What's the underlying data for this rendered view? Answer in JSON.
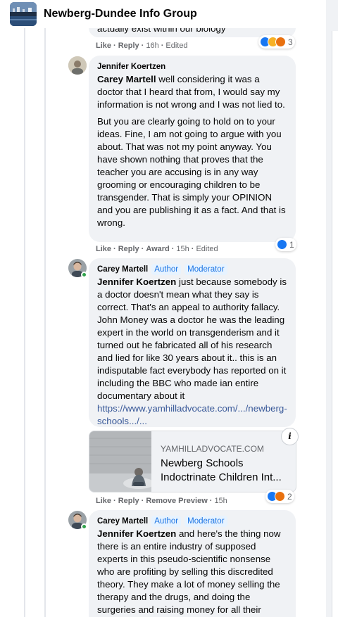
{
  "header": {
    "group_name": "Newberg-Dundee Info Group"
  },
  "prev_comment": {
    "tail_text": "actually exist within our biology",
    "actions": {
      "like": "Like",
      "reply": "Reply",
      "time": "16h",
      "edited": "Edited"
    },
    "reactions": {
      "icons": [
        "like-icon",
        "haha-icon",
        "angry-icon"
      ],
      "count": "3"
    }
  },
  "comments": [
    {
      "author": "Jennifer Koertzen",
      "paragraphs": [
        {
          "mention": "Carey Martell",
          "text": " well considering it was a doctor that I heard that from, I would say my information is not wrong and I was not lied to."
        },
        {
          "text": "But you are clearly going to hold on to your ideas. Fine, I am not going to argue with you about. That was not my point anyway. You have shown nothing that proves that the teacher you are accusing is in any way grooming or encouraging children to be transgender. That is simply your OPINION and you are publishing it as a fact. And that is wrong."
        }
      ],
      "actions": {
        "like": "Like",
        "reply": "Reply",
        "award": "Award",
        "time": "15h",
        "edited": "Edited"
      },
      "reactions": {
        "icons": [
          "like-icon"
        ],
        "count": "1"
      }
    },
    {
      "author": "Carey Martell",
      "badges": [
        "Author",
        "Moderator"
      ],
      "mention": "Jennifer Koertzen",
      "text": " just because somebody is a doctor doesn't mean what they say is correct. That's an appeal to authority fallacy. John Money was a doctor he was the leading expert in the world on transgenderism and it turned out he fabricated all of his research and lied for like 30 years about it.. this is an indisputable fact everybody has reported on it including the BBC who made ian entire documentary about it",
      "link": "https://www.yamhilladvocate.com/.../newberg-schools.../...",
      "preview": {
        "domain": "YAMHILLADVOCATE.COM",
        "title": "Newberg Schools Indoctrinate Children Int..."
      },
      "actions": {
        "like": "Like",
        "reply": "Reply",
        "remove_preview": "Remove Preview",
        "time": "15h"
      },
      "reactions": {
        "icons": [
          "like-icon",
          "angry-icon"
        ],
        "count": "2"
      }
    },
    {
      "author": "Carey Martell",
      "badges": [
        "Author",
        "Moderator"
      ],
      "mention": "Jennifer Koertzen",
      "text": " and here's the thing now there is an entire industry of supposed experts in this pseudo-scientific nonsense who are profiting by selling this discredited theory. They make a lot of money selling the therapy and the drugs, and doing the surgeries and raising money for all their"
    }
  ]
}
